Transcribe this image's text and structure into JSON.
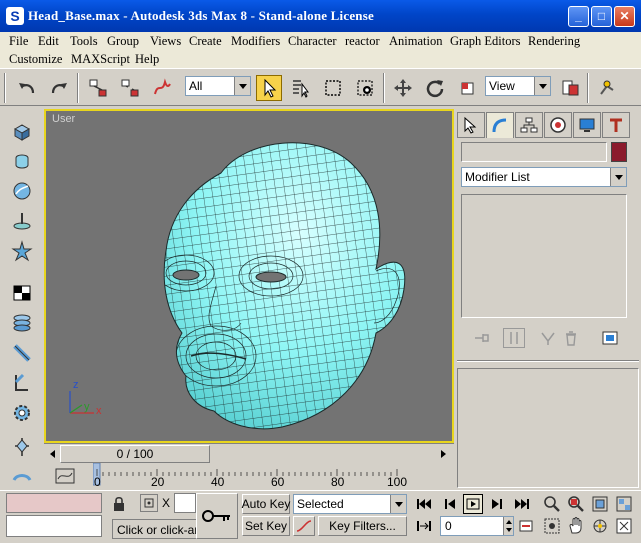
{
  "window": {
    "title": "Head_Base.max - Autodesk 3ds Max 8  - Stand-alone License",
    "app_icon": "S",
    "controls": {
      "minimize": "_",
      "maximize": "□",
      "close": "✕"
    }
  },
  "menu": {
    "row1": [
      "File",
      "Edit",
      "Tools",
      "Group",
      "Views",
      "Create",
      "Modifiers",
      "Character",
      "reactor",
      "Animation",
      "Graph Editors",
      "Rendering"
    ],
    "row2": [
      "Customize",
      "MAXScript",
      "Help"
    ]
  },
  "toolbar": {
    "selection_filter": "All",
    "reference_coord": "View"
  },
  "viewport": {
    "label": "User",
    "axis_z": "z",
    "axis_y": "y",
    "axis_x": "x"
  },
  "command_panel": {
    "modifier_list": "Modifier List",
    "object_color": "#8b1a2c"
  },
  "timeline": {
    "frame_counter": "0 / 100",
    "ticks": [
      "0",
      "20",
      "40",
      "60",
      "80",
      "100"
    ]
  },
  "status": {
    "prompt": "Click or click-an",
    "x_label": "X",
    "auto_key": "Auto Key",
    "set_key": "Set Key",
    "key_mode": "Selected",
    "key_filters": "Key Filters...",
    "current_frame": "0"
  },
  "colors": {
    "mesh": "#7ff3f2",
    "active_border": "#e8d51d",
    "viewport_bg": "#737373"
  }
}
